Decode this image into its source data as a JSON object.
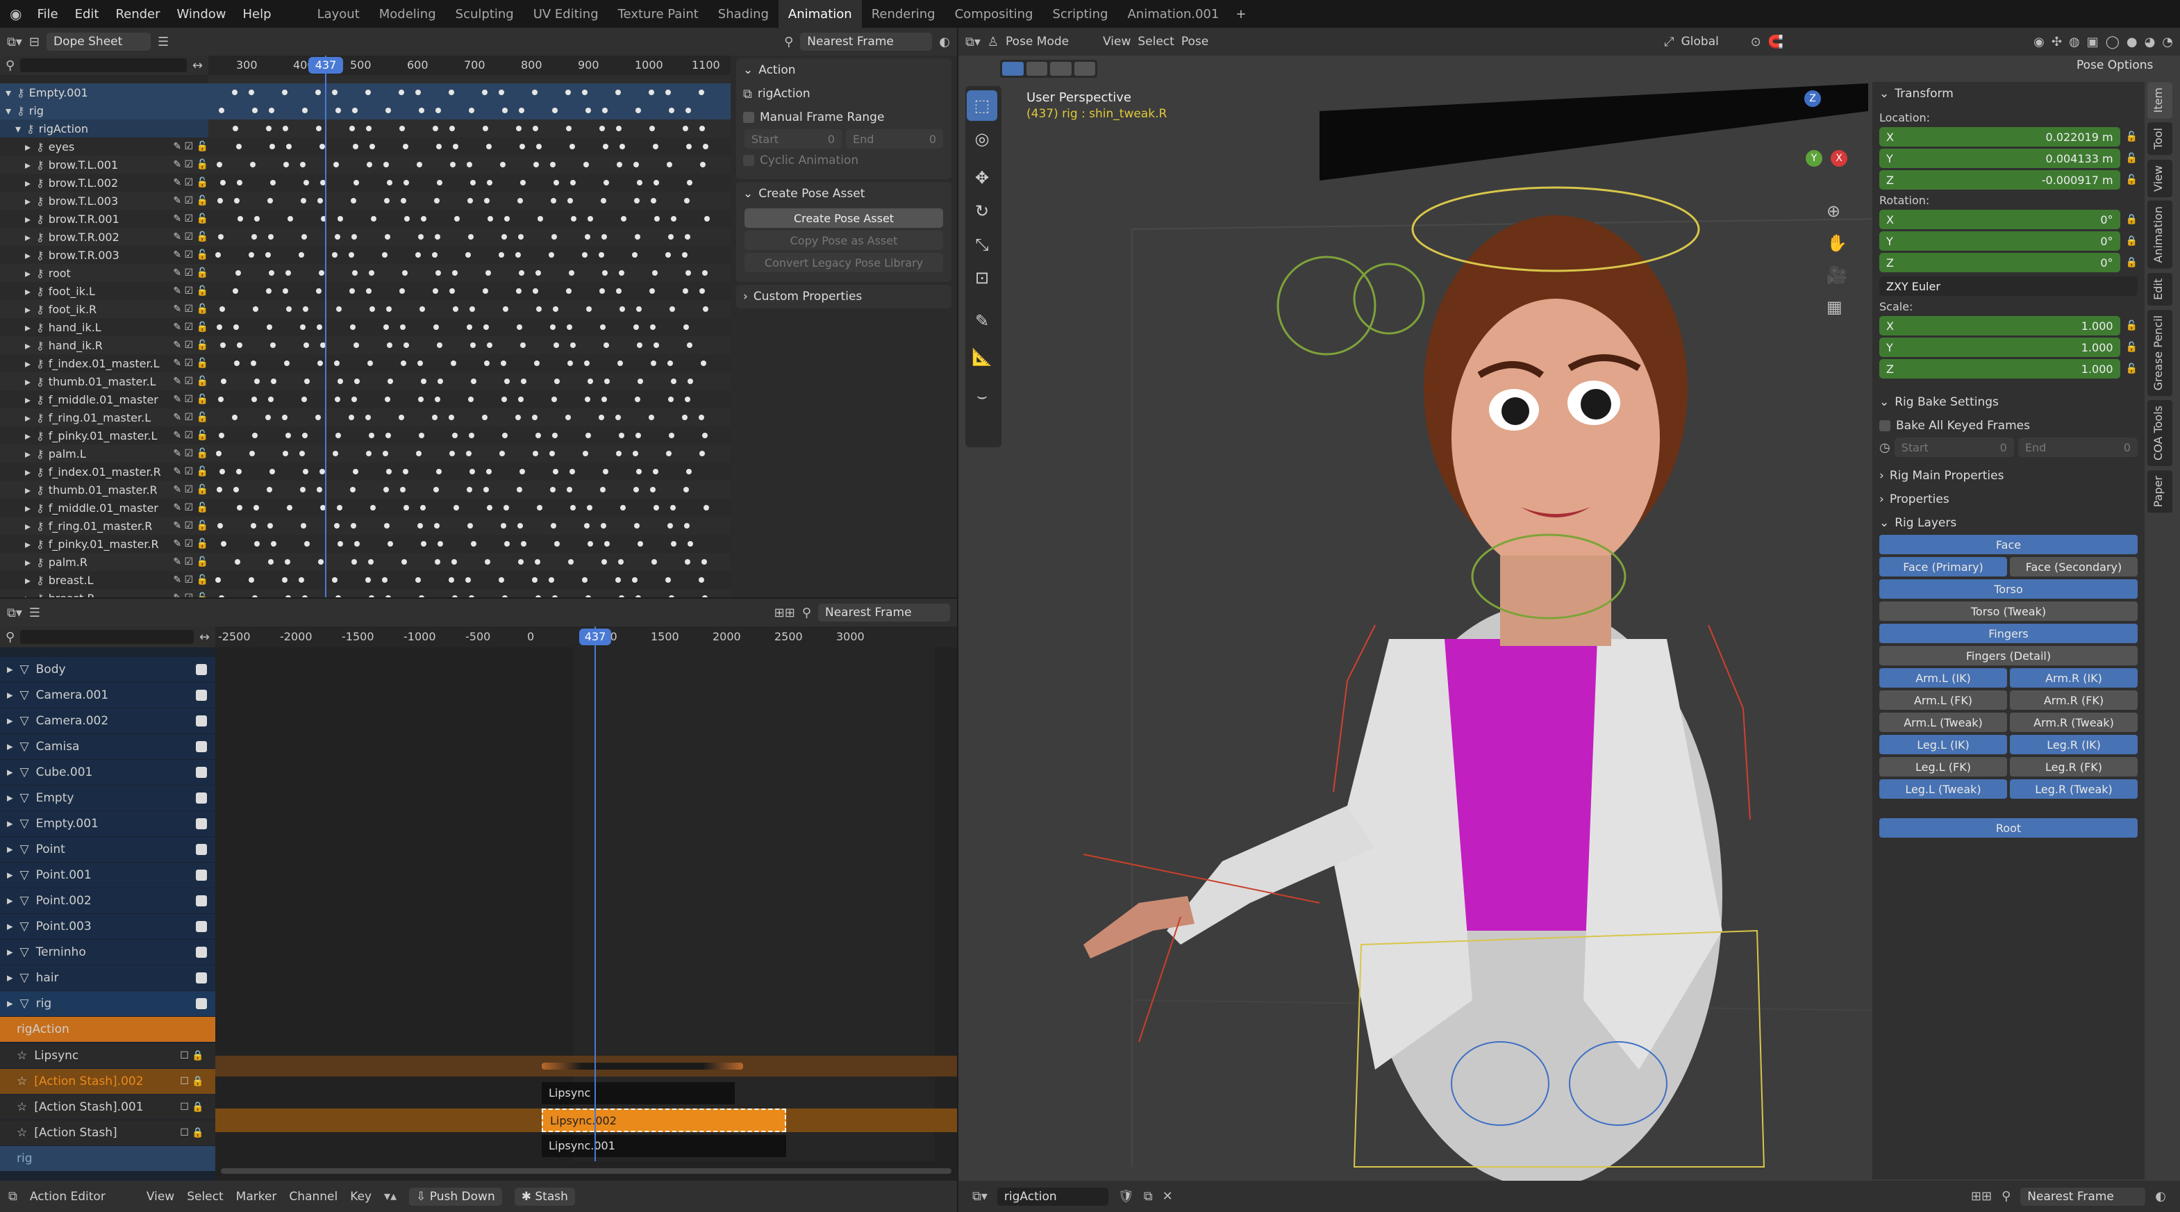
{
  "menu": {
    "file": "File",
    "edit": "Edit",
    "render": "Render",
    "window": "Window",
    "help": "Help"
  },
  "workspaces": [
    "Layout",
    "Modeling",
    "Sculpting",
    "UV Editing",
    "Texture Paint",
    "Shading",
    "Animation",
    "Rendering",
    "Compositing",
    "Scripting",
    "Animation.001"
  ],
  "active_workspace": "Animation",
  "dopesheet": {
    "mode": "Dope Sheet",
    "snap": "Nearest Frame",
    "frame_ticks": [
      "300",
      "400",
      "500",
      "600",
      "700",
      "800",
      "900",
      "1000",
      "1100"
    ],
    "current_frame": "437",
    "channels": [
      "Empty.001",
      "rig",
      "rigAction",
      "eyes",
      "brow.T.L.001",
      "brow.T.L.002",
      "brow.T.L.003",
      "brow.T.R.001",
      "brow.T.R.002",
      "brow.T.R.003",
      "root",
      "foot_ik.L",
      "foot_ik.R",
      "hand_ik.L",
      "hand_ik.R",
      "f_index.01_master.L",
      "thumb.01_master.L",
      "f_middle.01_master",
      "f_ring.01_master.L",
      "f_pinky.01_master.L",
      "palm.L",
      "f_index.01_master.R",
      "thumb.01_master.R",
      "f_middle.01_master",
      "f_ring.01_master.R",
      "f_pinky.01_master.R",
      "palm.R",
      "breast.L",
      "breast.R"
    ]
  },
  "action_panel": {
    "title": "Action",
    "action_name": "rigAction",
    "manual_frame_range": "Manual Frame Range",
    "start_label": "Start",
    "start_val": "0",
    "end_label": "End",
    "end_val": "0",
    "cyclic": "Cyclic Animation",
    "create_pose_title": "Create Pose Asset",
    "create_pose_btn": "Create Pose Asset",
    "copy_pose_btn": "Copy Pose as Asset",
    "convert_btn": "Convert Legacy Pose Library",
    "custom_props": "Custom Properties"
  },
  "nla": {
    "snap": "Nearest Frame",
    "ticks": [
      "-2500",
      "-2000",
      "-1500",
      "-1000",
      "-500",
      "0",
      "437",
      "1000",
      "1500",
      "2000",
      "2500",
      "3000"
    ],
    "rows": [
      "Body",
      "Camera.001",
      "Camera.002",
      "Camisa",
      "Cube.001",
      "Empty",
      "Empty.001",
      "Point",
      "Point.001",
      "Point.002",
      "Point.003",
      "Terninho",
      "hair",
      "rig"
    ],
    "rig_action": "rigAction",
    "tracks": [
      "Lipsync",
      "[Action Stash].002",
      "[Action Stash].001",
      "[Action Stash]"
    ],
    "strips": [
      "Lipsync",
      "Lipsync.002",
      "Lipsync.001"
    ],
    "last_row": "rig"
  },
  "bottom_left": {
    "editor": "Action Editor",
    "view": "View",
    "select": "Select",
    "marker": "Marker",
    "channel": "Channel",
    "key": "Key",
    "push_down": "Push Down",
    "stash": "Stash"
  },
  "bottom_right": {
    "action": "rigAction",
    "snap": "Nearest Frame"
  },
  "viewport": {
    "mode": "Pose Mode",
    "view": "View",
    "select": "Select",
    "pose": "Pose",
    "orientation": "Global",
    "perspective": "User Perspective",
    "selection_info": "(437) rig : shin_tweak.R",
    "pose_options": "Pose Options",
    "axis_x": "X",
    "axis_y": "Y",
    "axis_z": "Z"
  },
  "sidebar": {
    "tabs": [
      "Item",
      "Tool",
      "View",
      "Animation",
      "Edit",
      "Grease Pencil",
      "COA Tools",
      "Paper"
    ],
    "transform": "Transform",
    "location": "Location:",
    "loc": [
      {
        "a": "X",
        "v": "0.022019 m"
      },
      {
        "a": "Y",
        "v": "0.004133 m"
      },
      {
        "a": "Z",
        "v": "-0.000917 m"
      }
    ],
    "rotation": "Rotation:",
    "rot": [
      {
        "a": "X",
        "v": "0°"
      },
      {
        "a": "Y",
        "v": "0°"
      },
      {
        "a": "Z",
        "v": "0°"
      }
    ],
    "rot_mode": "ZXY Euler",
    "scale": "Scale:",
    "scl": [
      {
        "a": "X",
        "v": "1.000"
      },
      {
        "a": "Y",
        "v": "1.000"
      },
      {
        "a": "Z",
        "v": "1.000"
      }
    ],
    "rig_bake": "Rig Bake Settings",
    "bake_all": "Bake All Keyed Frames",
    "bake_start": "Start",
    "bake_start_val": "0",
    "bake_end": "End",
    "bake_end_val": "0",
    "rig_main": "Rig Main Properties",
    "properties": "Properties",
    "rig_layers": "Rig Layers",
    "layers": {
      "face": "Face",
      "face_primary": "Face (Primary)",
      "face_secondary": "Face (Secondary)",
      "torso": "Torso",
      "torso_tweak": "Torso (Tweak)",
      "fingers": "Fingers",
      "fingers_detail": "Fingers (Detail)",
      "arm_l_ik": "Arm.L (IK)",
      "arm_r_ik": "Arm.R (IK)",
      "arm_l_fk": "Arm.L (FK)",
      "arm_r_fk": "Arm.R (FK)",
      "arm_l_tweak": "Arm.L (Tweak)",
      "arm_r_tweak": "Arm.R (Tweak)",
      "leg_l_ik": "Leg.L (IK)",
      "leg_r_ik": "Leg.R (IK)",
      "leg_l_fk": "Leg.L (FK)",
      "leg_r_fk": "Leg.R (FK)",
      "leg_l_tweak": "Leg.L (Tweak)",
      "leg_r_tweak": "Leg.R (Tweak)",
      "root": "Root"
    }
  },
  "colors": {
    "accent": "#4772b3",
    "selected_orange": "#e98a1b",
    "green_field": "#3e7b31",
    "playhead": "#4a7ad6"
  }
}
